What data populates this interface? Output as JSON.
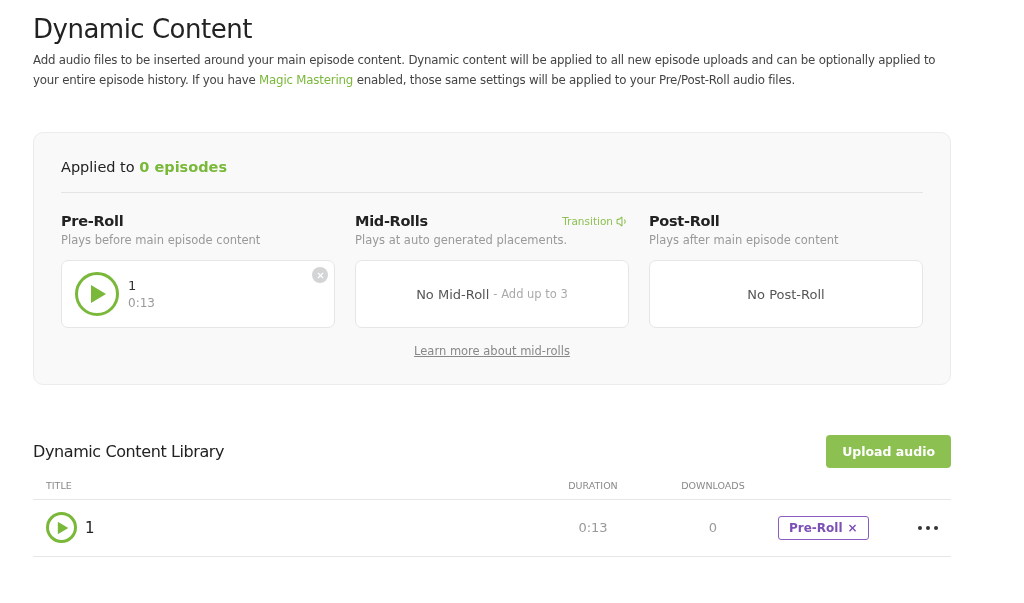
{
  "title": "Dynamic Content",
  "intro": {
    "before": "Add audio files to be inserted around your main episode content. Dynamic content will be applied to all new episode uploads and can be optionally applied to your entire episode history. If you have",
    "link": "Magic Mastering",
    "after": "enabled, those same settings will be applied to your Pre/Post-Roll audio files."
  },
  "applied": {
    "label": "Applied to",
    "count": "0 episodes"
  },
  "slots": [
    {
      "title": "Pre-Roll",
      "subtitle": "Plays before main episode content",
      "kind": "clip",
      "clip": {
        "name": "1",
        "duration": "0:13"
      }
    },
    {
      "title": "Mid-Rolls",
      "subtitle": "Plays at auto generated placements.",
      "kind": "empty",
      "transition": "Transition",
      "empty": "No Mid-Roll",
      "hint": "- Add up to 3",
      "link": "Learn more about mid-rolls"
    },
    {
      "title": "Post-Roll",
      "subtitle": "Plays after main episode content",
      "kind": "empty",
      "empty": "No Post-Roll"
    }
  ],
  "library": {
    "title": "Dynamic Content Library",
    "upload": "Upload audio",
    "columns": [
      "TITLE",
      "DURATION",
      "DOWNLOADS"
    ],
    "rows": [
      {
        "title": "1",
        "duration": "0:13",
        "downloads": "0",
        "tag": "Pre-Roll",
        "tag_remove": "×"
      }
    ]
  }
}
